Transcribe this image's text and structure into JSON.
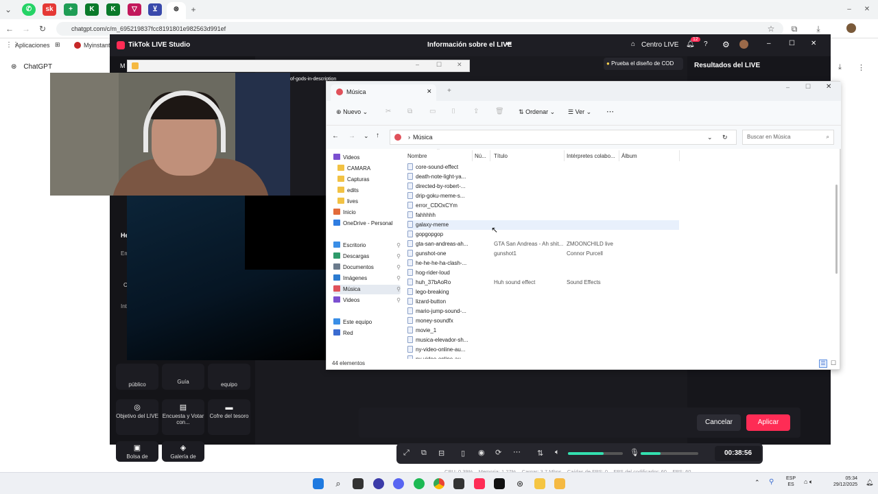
{
  "browser": {
    "url": "chatgpt.com/c/m_695219837fcc8191801e982563d991ef",
    "bookmarks": {
      "apps": "Aplicaciones",
      "myinstants": "Myinstants"
    },
    "sidebar_label": "ChatGPT"
  },
  "tiktok": {
    "app_title": "TikTok LIVE Studio",
    "center_title": "Información sobre el LIVE",
    "live_center": "Centro LIVE",
    "notif_count": "12",
    "hint": "Prueba el diseño de COD",
    "results_title": "Resultados del LIVE",
    "overlay_text": "of-gods-in-description",
    "left_labels": {
      "he": "He",
      "em": "Em",
      "int": "Int",
      "c": "C"
    },
    "cards": [
      {
        "icon": "user-icon",
        "label": "público"
      },
      {
        "icon": "guide-icon",
        "label": "Guía"
      },
      {
        "icon": "team-icon",
        "label": "equipo"
      },
      {
        "icon": "target-icon",
        "label": "Objetivo del LIVE"
      },
      {
        "icon": "poll-icon",
        "label": "Encuesta y Votar con..."
      },
      {
        "icon": "chest-icon",
        "label": "Cofre del tesoro"
      },
      {
        "icon": "bag-icon",
        "label": "Bolsa de"
      },
      {
        "icon": "gallery-icon",
        "label": "Galería de"
      }
    ],
    "cancel": "Cancelar",
    "apply": "Aplicar",
    "timer": "00:38:56",
    "volume_level": 0.65,
    "mic_level": 0.35,
    "stats": {
      "cpu": "CPU: 0.39%",
      "memory": "Memoria: 1.27%",
      "load": "Cargar: 3.7 Mbps",
      "fps_drop": "Caídas de FPS: 0",
      "encoder_fps": "FPS del codificador: 60",
      "fps": "FPS: 60"
    },
    "accent": "#fe2c55"
  },
  "explorer": {
    "tab_title": "Música",
    "toolbar": {
      "new": "Nuevo",
      "sort": "Ordenar",
      "view": "Ver"
    },
    "path": "Música",
    "search_placeholder": "Buscar en Música",
    "sidebar": [
      {
        "label": "Videos",
        "color": "#7b4fd0",
        "pin": false
      },
      {
        "label": "CAMARA",
        "color": "#f2c244",
        "pin": false
      },
      {
        "label": "Capturas",
        "color": "#f2c244",
        "pin": false
      },
      {
        "label": "edits",
        "color": "#f2c244",
        "pin": false
      },
      {
        "label": "lives",
        "color": "#f2c244",
        "pin": false
      },
      {
        "label": "Inicio",
        "color": "#e26b3a",
        "pin": false
      },
      {
        "label": "OneDrive - Personal",
        "color": "#2f7de1",
        "pin": false
      },
      {
        "label": "Escritorio",
        "color": "#3a8ee6",
        "pin": true
      },
      {
        "label": "Descargas",
        "color": "#2e9a6a",
        "pin": true
      },
      {
        "label": "Documentos",
        "color": "#6b7b8c",
        "pin": true
      },
      {
        "label": "Imágenes",
        "color": "#2c7bd0",
        "pin": true
      },
      {
        "label": "Música",
        "color": "#e0515a",
        "pin": true
      },
      {
        "label": "Videos",
        "color": "#7b4fd0",
        "pin": true
      },
      {
        "label": "Este equipo",
        "color": "#3a8ee6",
        "pin": false
      },
      {
        "label": "Red",
        "color": "#3a6bd0",
        "pin": false
      }
    ],
    "columns": {
      "name": "Nombre",
      "num": "Nú...",
      "title": "Título",
      "artists": "Intérpretes colabo...",
      "album": "Álbum"
    },
    "files": [
      {
        "name": "core-sound-effect",
        "title": "",
        "artist": ""
      },
      {
        "name": "death-note-light-ya...",
        "title": "",
        "artist": ""
      },
      {
        "name": "directed-by-robert-...",
        "title": "",
        "artist": ""
      },
      {
        "name": "drip-goku-meme-s...",
        "title": "",
        "artist": ""
      },
      {
        "name": "error_CDOxCYm",
        "title": "",
        "artist": ""
      },
      {
        "name": "fahhhhh",
        "title": "",
        "artist": ""
      },
      {
        "name": "galaxy-meme",
        "title": "",
        "artist": ""
      },
      {
        "name": "gopgopgop",
        "title": "",
        "artist": ""
      },
      {
        "name": "gta-san-andreas-ah...",
        "title": "GTA San Andreas - Ah shit...",
        "artist": "ZMOONCHILD live"
      },
      {
        "name": "gunshot-one",
        "title": "gunshot1",
        "artist": "Connor Purcell"
      },
      {
        "name": "he-he-he-ha-clash-...",
        "title": "",
        "artist": ""
      },
      {
        "name": "hog-rider-loud",
        "title": "",
        "artist": ""
      },
      {
        "name": "huh_37bAoRo",
        "title": "Huh sound effect",
        "artist": "Sound Effects"
      },
      {
        "name": "lego-breaking",
        "title": "",
        "artist": ""
      },
      {
        "name": "lizard-button",
        "title": "",
        "artist": ""
      },
      {
        "name": "mario-jump-sound-...",
        "title": "",
        "artist": ""
      },
      {
        "name": "money-soundfx",
        "title": "",
        "artist": ""
      },
      {
        "name": "movie_1",
        "title": "",
        "artist": ""
      },
      {
        "name": "musica-elevador-sh...",
        "title": "",
        "artist": ""
      },
      {
        "name": "ny-video-online-au...",
        "title": "",
        "artist": ""
      },
      {
        "name": "ny-video-online-au...",
        "title": "",
        "artist": ""
      }
    ],
    "selected_file": "galaxy-meme",
    "status": "44 elementos"
  },
  "taskbar": {
    "lang": "ESP",
    "lang2": "ES",
    "time": "05:34",
    "date": "29/12/2025"
  }
}
